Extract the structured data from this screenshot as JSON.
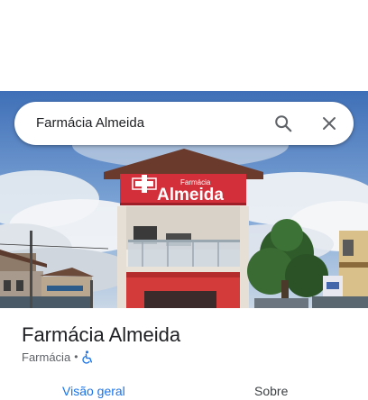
{
  "search": {
    "query": "Farmácia Almeida",
    "search_icon": "search-icon",
    "clear_icon": "close-icon"
  },
  "photo": {
    "sign_small": "Farmácia",
    "sign_large": "Almeida",
    "sign_symbol": "cross-icon",
    "sign_color": "#d32f3a"
  },
  "place": {
    "name": "Farmácia Almeida",
    "category": "Farmácia",
    "separator": "•",
    "accessibility_icon": "wheelchair-icon"
  },
  "tabs": [
    {
      "label": "Visão geral",
      "active": true
    },
    {
      "label": "Sobre",
      "active": false
    }
  ],
  "colors": {
    "accent": "#1a73e8",
    "text": "#202124",
    "secondary_text": "#5f6368"
  }
}
